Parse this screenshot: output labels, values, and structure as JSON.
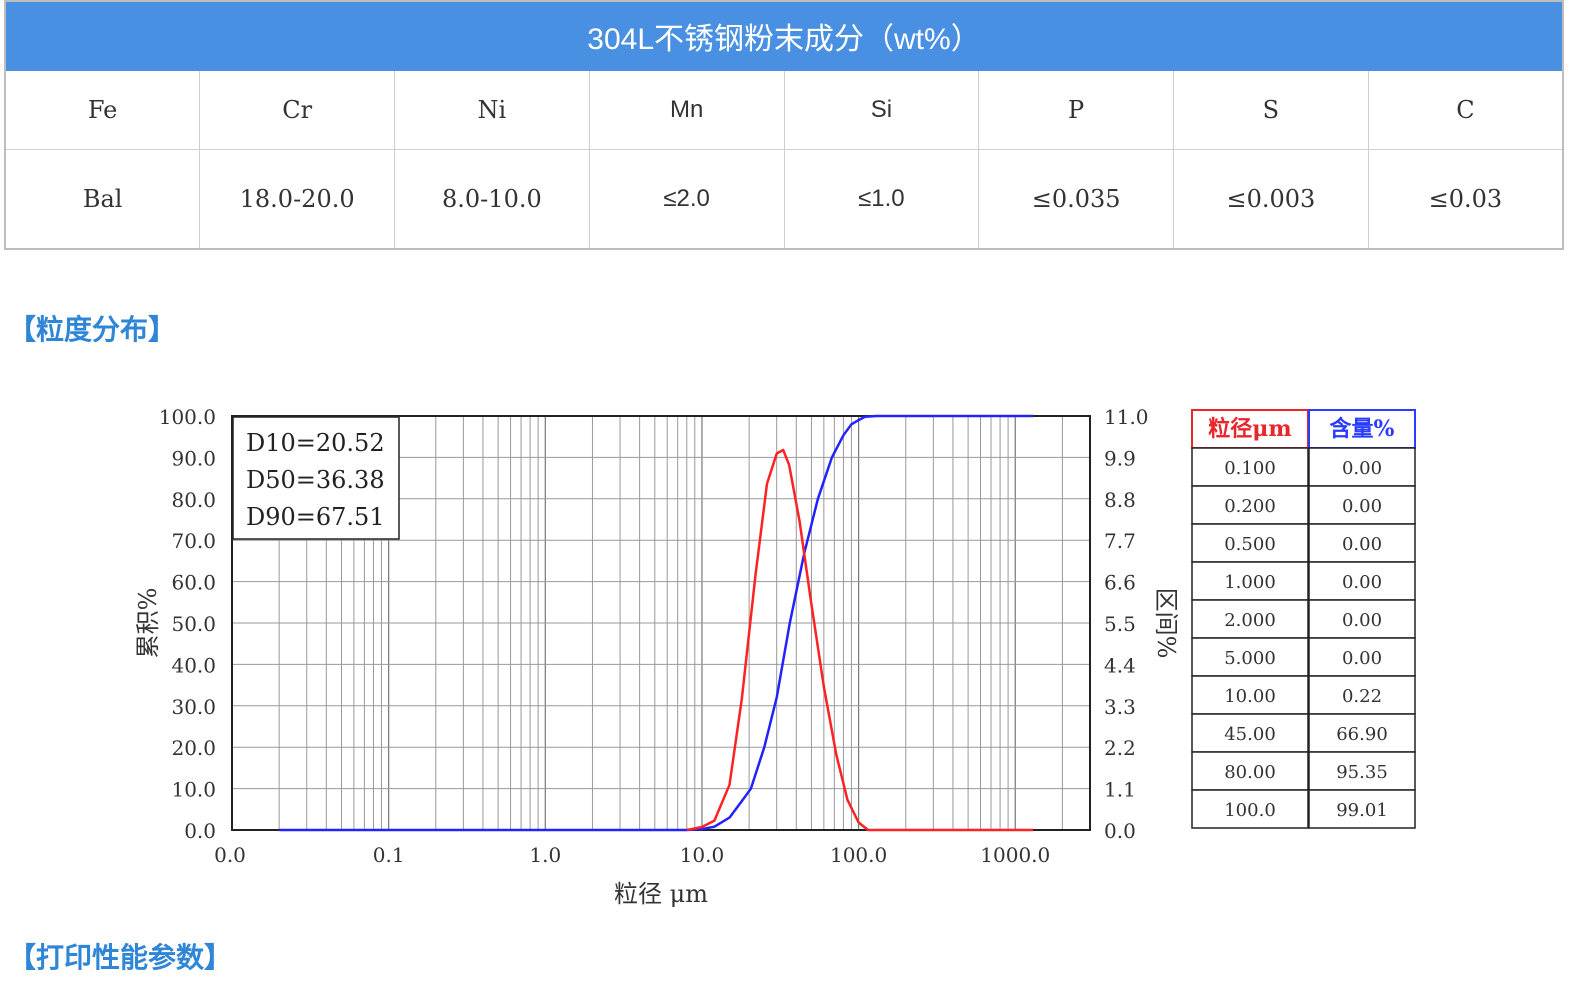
{
  "composition": {
    "title": "304L不锈钢粉末成分（wt%）",
    "headers": [
      "Fe",
      "Cr",
      "Ni",
      "Mn",
      "Si",
      "P",
      "S",
      "C"
    ],
    "values": [
      "Bal",
      "18.0-20.0",
      "8.0-10.0",
      "≤2.0",
      "≤1.0",
      "≤0.035",
      "≤0.003",
      "≤0.03"
    ]
  },
  "sections": {
    "distribution": "【粒度分布】",
    "printing": "【打印性能参数】"
  },
  "chart_data": {
    "type": "line",
    "x_scale": "log",
    "xlabel": "粒径 μm",
    "ylabel_left": "累积%",
    "ylabel_right": "区间%",
    "x_tick_labels": [
      "0.0",
      "0.1",
      "1.0",
      "10.0",
      "100.0",
      "1000.0"
    ],
    "x_ticks": [
      0.01,
      0.1,
      1,
      10,
      100,
      1000
    ],
    "xlim": [
      0.01,
      3000
    ],
    "y_left_ticks": [
      "0.0",
      "10.0",
      "20.0",
      "30.0",
      "40.0",
      "50.0",
      "60.0",
      "70.0",
      "80.0",
      "90.0",
      "100.0"
    ],
    "y_left_lim": [
      0,
      100
    ],
    "y_right_ticks": [
      "0.0",
      "1.1",
      "2.2",
      "3.3",
      "4.4",
      "5.5",
      "6.6",
      "7.7",
      "8.8",
      "9.9",
      "11.0"
    ],
    "y_right_lim": [
      0,
      11
    ],
    "annotation": [
      "D10=20.52",
      "D50=36.38",
      "D90=67.51"
    ],
    "series": [
      {
        "axis": "left",
        "color": "#2222ff",
        "points": [
          [
            0.02,
            0
          ],
          [
            8,
            0
          ],
          [
            10,
            0.22
          ],
          [
            12,
            0.8
          ],
          [
            15,
            3
          ],
          [
            18,
            7
          ],
          [
            20.52,
            10
          ],
          [
            25,
            20
          ],
          [
            30,
            32
          ],
          [
            36.38,
            50
          ],
          [
            45,
            66.9
          ],
          [
            55,
            80
          ],
          [
            67.51,
            90
          ],
          [
            80,
            95.35
          ],
          [
            90,
            98
          ],
          [
            100,
            99.01
          ],
          [
            110,
            99.8
          ],
          [
            130,
            100
          ],
          [
            1300,
            100
          ]
        ]
      },
      {
        "axis": "right",
        "color": "#ff2222",
        "points": [
          [
            8,
            0
          ],
          [
            10,
            0.08
          ],
          [
            12,
            0.25
          ],
          [
            15,
            1.2
          ],
          [
            18,
            3.5
          ],
          [
            22,
            6.8
          ],
          [
            26,
            9.2
          ],
          [
            30,
            10.0
          ],
          [
            33,
            10.1
          ],
          [
            36,
            9.7
          ],
          [
            42,
            8.2
          ],
          [
            50,
            6.0
          ],
          [
            60,
            3.8
          ],
          [
            72,
            2.0
          ],
          [
            85,
            0.8
          ],
          [
            100,
            0.2
          ],
          [
            115,
            0
          ],
          [
            1300,
            0
          ]
        ]
      }
    ]
  },
  "size_table": {
    "headers": [
      "粒径μm",
      "含量%"
    ],
    "header_color": "#e8262c",
    "header2_color": "#2a3cff",
    "rows": [
      [
        "0.100",
        "0.00"
      ],
      [
        "0.200",
        "0.00"
      ],
      [
        "0.500",
        "0.00"
      ],
      [
        "1.000",
        "0.00"
      ],
      [
        "2.000",
        "0.00"
      ],
      [
        "5.000",
        "0.00"
      ],
      [
        "10.00",
        "0.22"
      ],
      [
        "45.00",
        "66.90"
      ],
      [
        "80.00",
        "95.35"
      ],
      [
        "100.0",
        "99.01"
      ]
    ]
  }
}
